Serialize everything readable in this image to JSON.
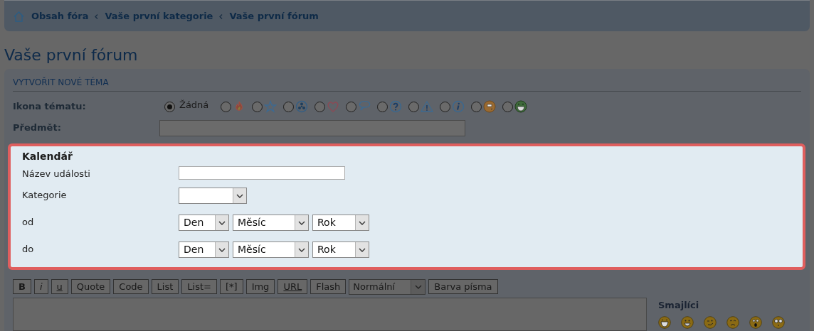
{
  "breadcrumbs": [
    {
      "label": "Obsah fóra",
      "kind": "home"
    },
    {
      "label": "Vaše první kategorie",
      "kind": "crumb"
    },
    {
      "label": "Vaše první fórum",
      "kind": "crumb"
    }
  ],
  "page_title": "Vaše první fórum",
  "form": {
    "heading": "VYTVOŘIT NOVÉ TÉMA",
    "topic_icon": {
      "label": "Ikona tématu:",
      "options": [
        {
          "kind": "none",
          "label": "Žádná",
          "selected": true
        },
        {
          "kind": "fire",
          "selected": false
        },
        {
          "kind": "star",
          "selected": false
        },
        {
          "kind": "radioactive",
          "selected": false
        },
        {
          "kind": "heart",
          "selected": false
        },
        {
          "kind": "thought",
          "selected": false
        },
        {
          "kind": "question",
          "selected": false
        },
        {
          "kind": "warning",
          "selected": false
        },
        {
          "kind": "info",
          "selected": false
        },
        {
          "kind": "face-orange",
          "selected": false
        },
        {
          "kind": "face-green",
          "selected": false
        }
      ]
    },
    "subject": {
      "label": "Předmět:"
    }
  },
  "calendar": {
    "title": "Kalendář",
    "rows": [
      {
        "kind": "text",
        "label": "Název události"
      },
      {
        "kind": "select",
        "label": "Kategorie"
      },
      {
        "kind": "date",
        "label": "od",
        "selects": [
          "Den",
          "Měsíc",
          "Rok"
        ]
      },
      {
        "kind": "date",
        "label": "do",
        "selects": [
          "Den",
          "Měsíc",
          "Rok"
        ]
      }
    ]
  },
  "toolbar": [
    {
      "kind": "bold",
      "label": "B"
    },
    {
      "kind": "italic",
      "label": "i"
    },
    {
      "kind": "underline",
      "label": "u"
    },
    {
      "kind": "plain",
      "label": "Quote"
    },
    {
      "kind": "plain",
      "label": "Code"
    },
    {
      "kind": "plain",
      "label": "List"
    },
    {
      "kind": "plain",
      "label": "List="
    },
    {
      "kind": "plain",
      "label": "[*]"
    },
    {
      "kind": "plain",
      "label": "Img"
    },
    {
      "kind": "underline",
      "label": "URL"
    },
    {
      "kind": "plain",
      "label": "Flash"
    },
    {
      "kind": "select",
      "label": "Normální"
    },
    {
      "kind": "plain",
      "label": "Barva písma"
    }
  ],
  "smileys": {
    "title": "Smajlíci"
  }
}
